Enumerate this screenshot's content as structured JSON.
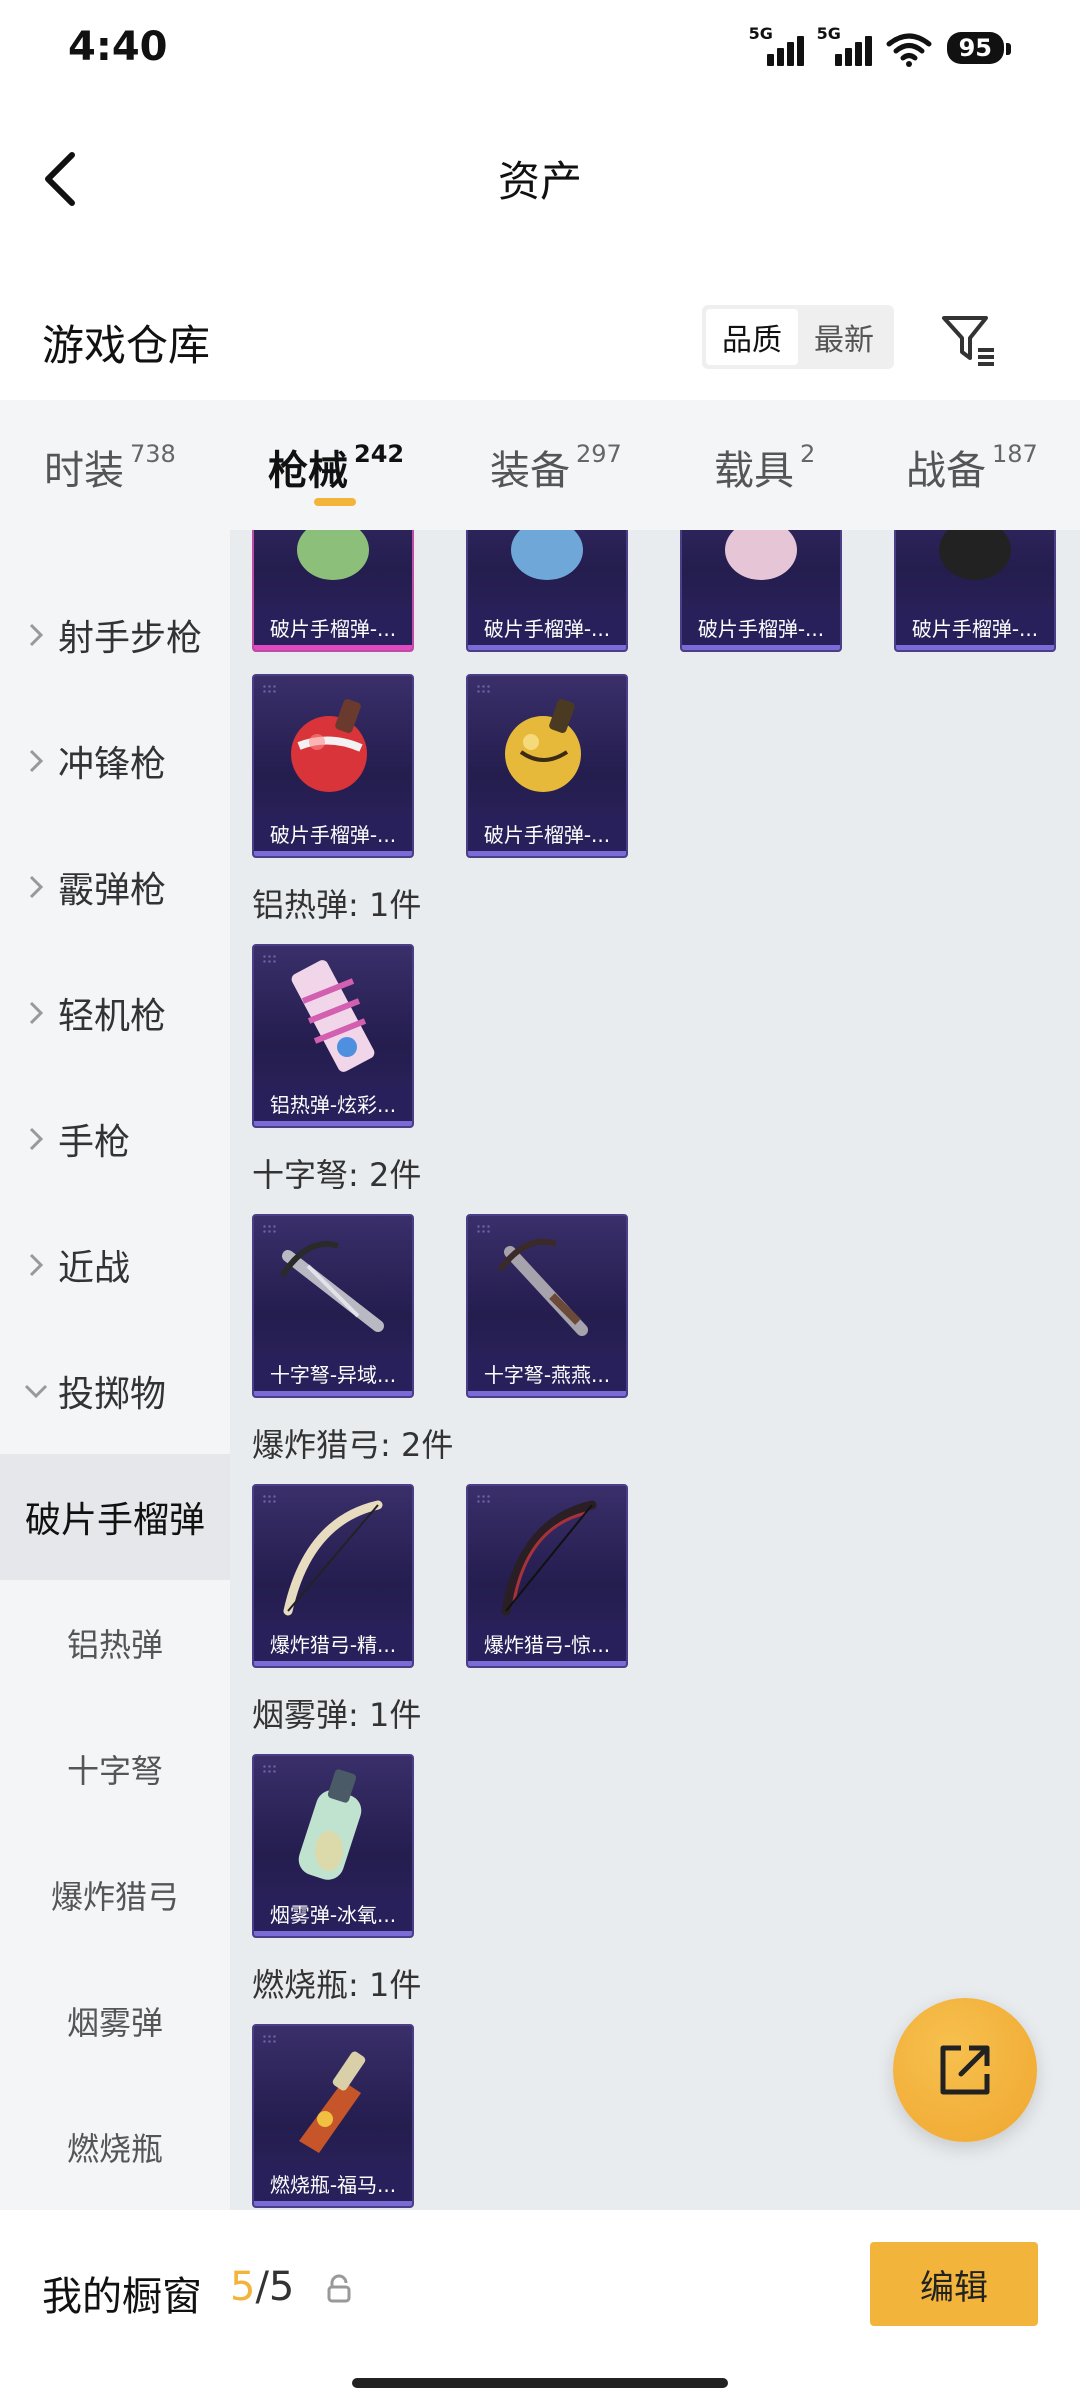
{
  "status": {
    "time": "4:40",
    "signal1": "5G",
    "signal2": "5G",
    "battery": "95"
  },
  "header": {
    "title": "资产"
  },
  "warehouse": {
    "title": "游戏仓库",
    "sort_options": [
      "品质",
      "最新"
    ]
  },
  "tabs": [
    {
      "label": "时装",
      "count": "738"
    },
    {
      "label": "枪械",
      "count": "242"
    },
    {
      "label": "装备",
      "count": "297"
    },
    {
      "label": "载具",
      "count": "2"
    },
    {
      "label": "战备",
      "count": "187"
    }
  ],
  "sidebar": {
    "categories": [
      "射手步枪",
      "冲锋枪",
      "霰弹枪",
      "轻机枪",
      "手枪",
      "近战",
      "投掷物"
    ],
    "subcategories": [
      "破片手榴弹",
      "铝热弹",
      "十字弩",
      "爆炸猎弓",
      "烟雾弹",
      "燃烧瓶"
    ]
  },
  "content": {
    "top_items": [
      "破片手榴弹-...",
      "破片手榴弹-...",
      "破片手榴弹-...",
      "破片手榴弹-..."
    ],
    "grenade_items": [
      "破片手榴弹-...",
      "破片手榴弹-..."
    ],
    "groups": [
      {
        "label": "铝热弹: 1件",
        "items": [
          "铝热弹-炫彩..."
        ]
      },
      {
        "label": "十字弩: 2件",
        "items": [
          "十字弩-异域...",
          "十字弩-燕燕..."
        ]
      },
      {
        "label": "爆炸猎弓: 2件",
        "items": [
          "爆炸猎弓-精...",
          "爆炸猎弓-惊..."
        ]
      },
      {
        "label": "烟雾弹: 1件",
        "items": [
          "烟雾弹-冰氧..."
        ]
      },
      {
        "label": "燃烧瓶: 1件",
        "items": [
          "燃烧瓶-福马..."
        ]
      }
    ]
  },
  "bottom": {
    "showcase_label": "我的橱窗",
    "showcase_used": "5",
    "showcase_total": "/5",
    "edit_label": "编辑"
  },
  "colors": {
    "accent": "#f3b43b",
    "card_bg": "#2a2258",
    "pink_border": "#e04ac0"
  }
}
